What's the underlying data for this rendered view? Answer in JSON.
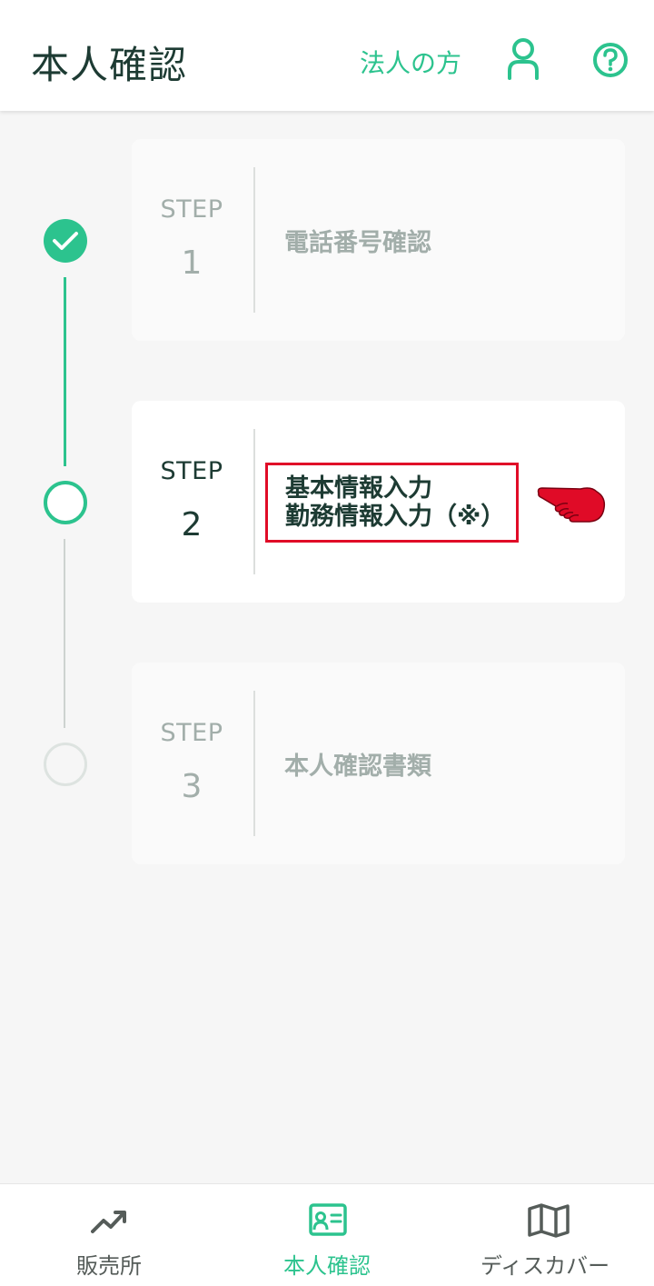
{
  "header": {
    "title": "本人確認",
    "corporate_link": "法人の方",
    "user_icon": "user-icon",
    "help_icon": "help-circle-icon"
  },
  "steps": [
    {
      "label": "STEP",
      "number": "1",
      "title": "電話番号確認",
      "status": "completed"
    },
    {
      "label": "STEP",
      "number": "2",
      "title_line1": "基本情報入力",
      "title_line2": "勤務情報入力（※）",
      "status": "current"
    },
    {
      "label": "STEP",
      "number": "3",
      "title": "本人確認書類",
      "status": "upcoming"
    }
  ],
  "bottom_nav": [
    {
      "label": "販売所",
      "icon": "trending-up-icon",
      "active": false
    },
    {
      "label": "本人確認",
      "icon": "id-card-icon",
      "active": true
    },
    {
      "label": "ディスカバー",
      "icon": "map-icon",
      "active": false
    }
  ],
  "colors": {
    "accent": "#2cc38e",
    "text_dark": "#1d3b33",
    "text_muted": "#a2aeaa",
    "highlight_box": "#e00b27",
    "pointer": "#e00b27"
  }
}
